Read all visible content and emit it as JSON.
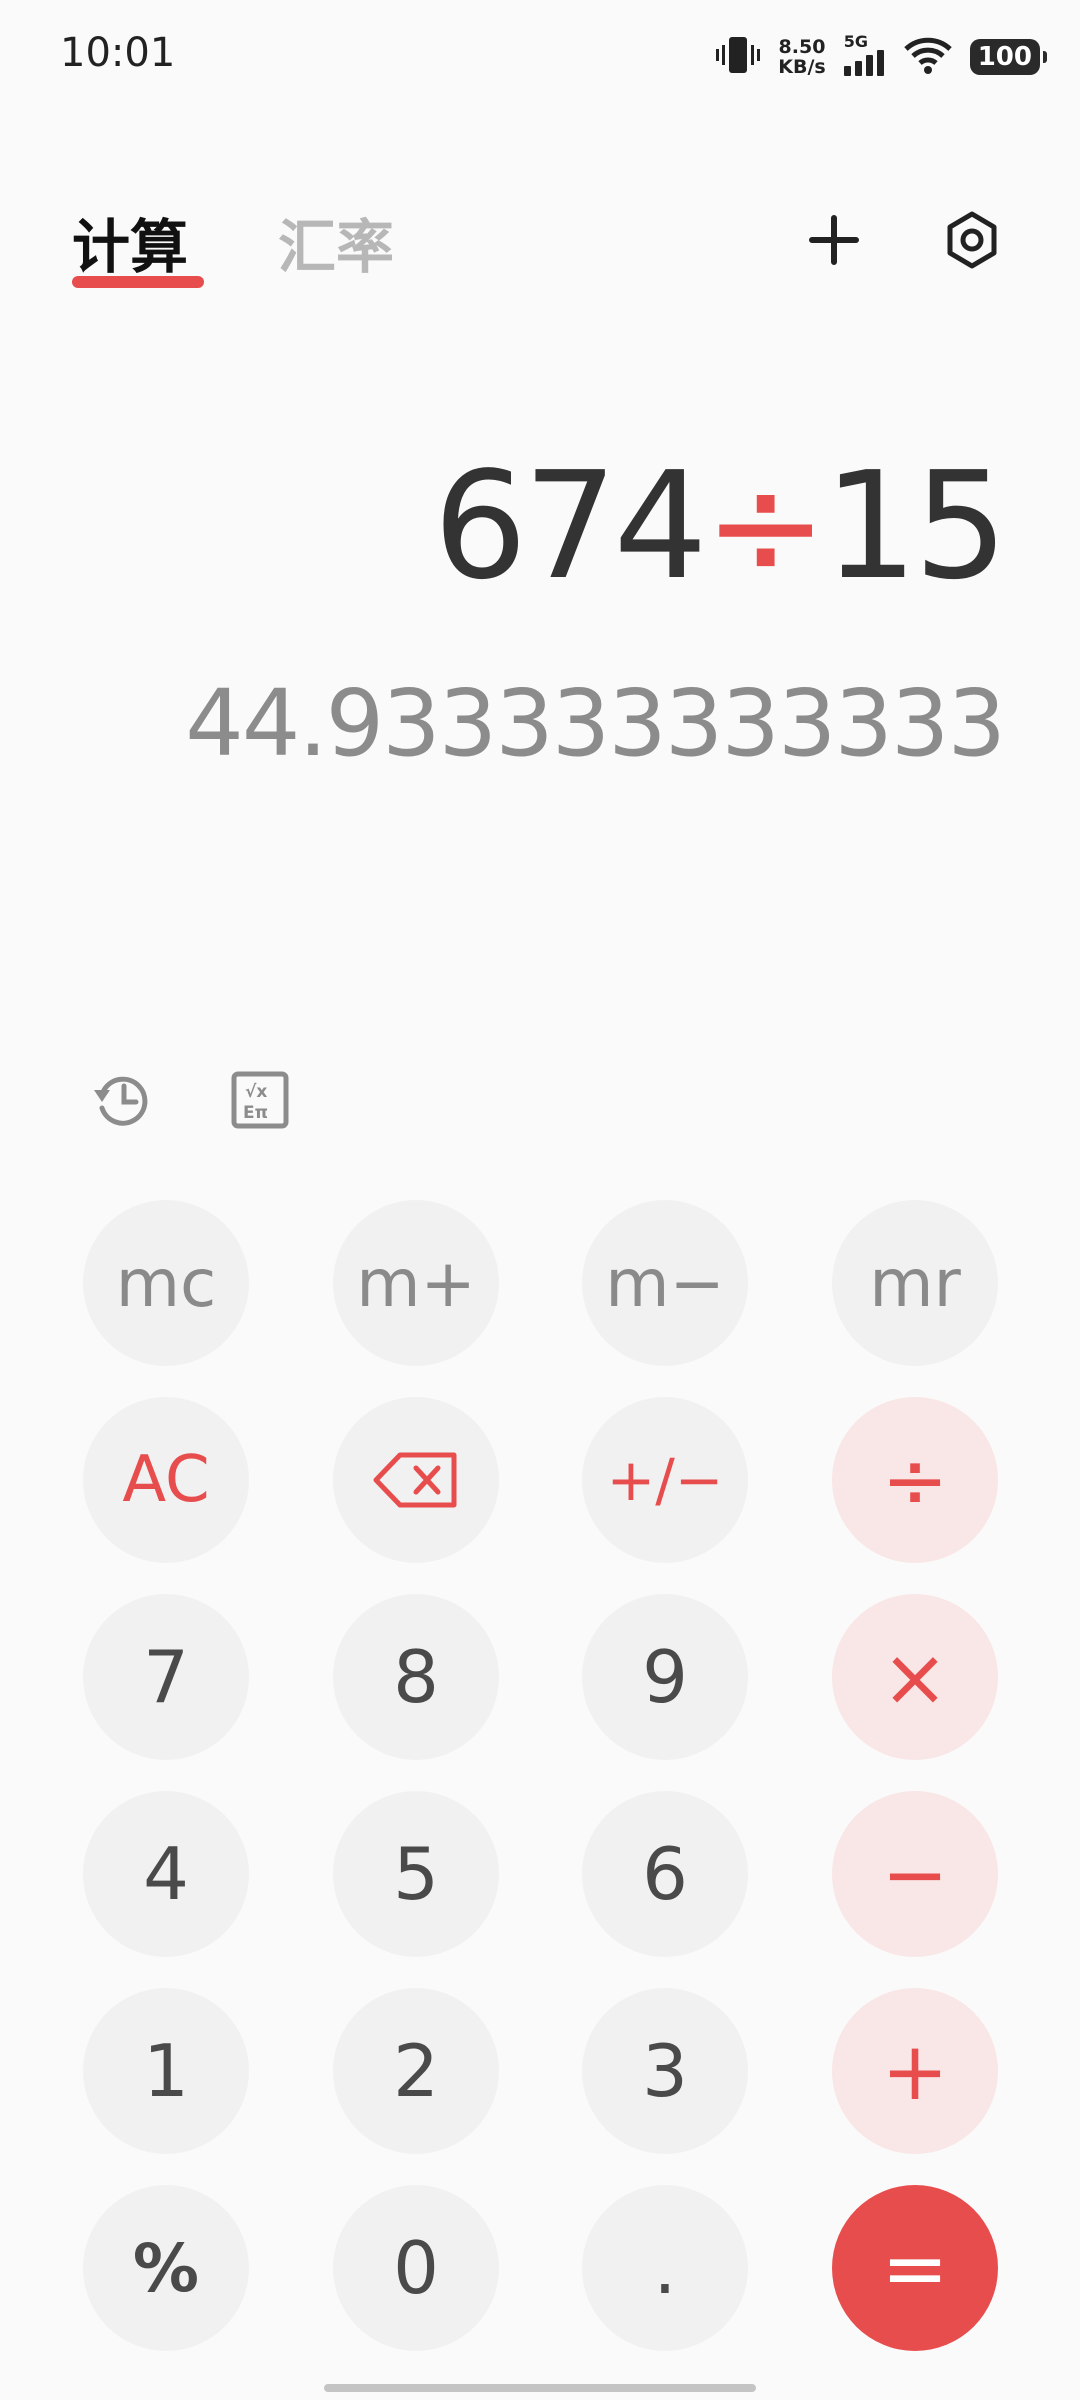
{
  "status": {
    "time": "10:01",
    "net_speed_value": "8.50",
    "net_speed_unit": "KB/s",
    "network": "5G",
    "battery": "100",
    "icons": [
      "vibrate-icon",
      "signal-icon",
      "wifi-icon",
      "battery-icon"
    ]
  },
  "tabs": [
    {
      "label": "计算",
      "active": true
    },
    {
      "label": "汇率",
      "active": false
    }
  ],
  "header_icons": [
    "collapse-icon",
    "settings-icon"
  ],
  "display": {
    "expression_left": "674",
    "expression_op": "÷",
    "expression_right": "15",
    "result": "44.933333333333"
  },
  "tools": [
    "history-icon",
    "scientific-icon"
  ],
  "keys": {
    "mc": "mc",
    "mplus": "m+",
    "mminus": "m−",
    "mr": "mr",
    "ac": "AC",
    "sign": "+/−",
    "divide": "÷",
    "k7": "7",
    "k8": "8",
    "k9": "9",
    "multiply": "×",
    "k4": "4",
    "k5": "5",
    "k6": "6",
    "minus": "−",
    "k1": "1",
    "k2": "2",
    "k3": "3",
    "plus": "+",
    "percent": "%",
    "k0": "0",
    "dot": ".",
    "equals": "="
  },
  "colors": {
    "accent": "#e84d4d",
    "key_bg": "#f1f1f1",
    "op_key_bg": "#f9e6e6",
    "background": "#fafafa"
  }
}
